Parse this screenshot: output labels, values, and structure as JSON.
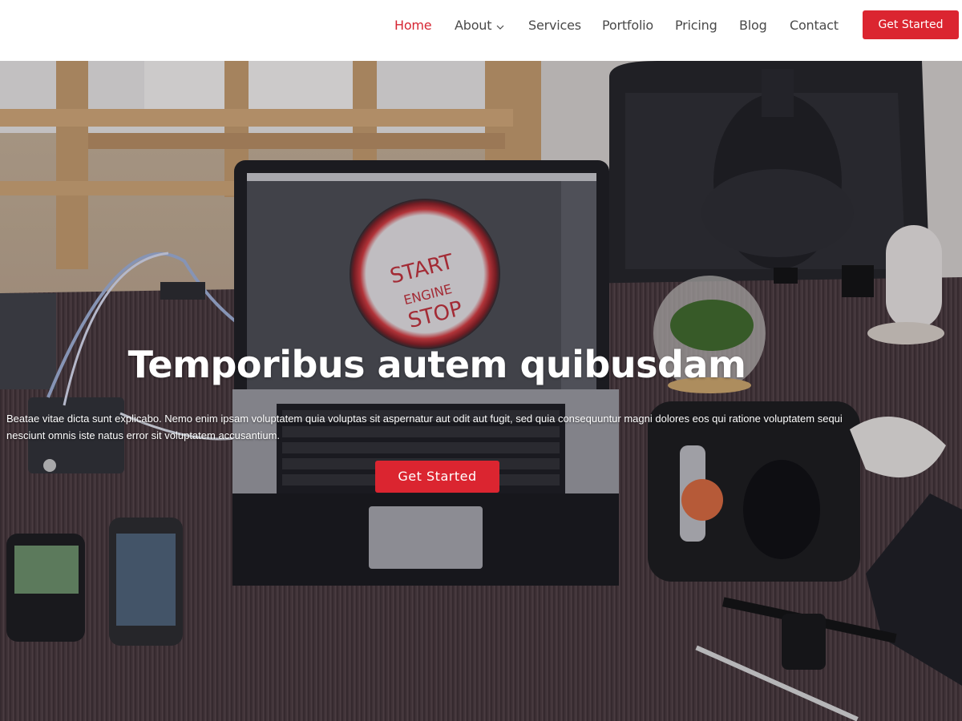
{
  "nav": {
    "items": [
      {
        "label": "Home",
        "active": true
      },
      {
        "label": "About",
        "has_dropdown": true
      },
      {
        "label": "Services"
      },
      {
        "label": "Portfolio"
      },
      {
        "label": "Pricing"
      },
      {
        "label": "Blog"
      },
      {
        "label": "Contact"
      }
    ],
    "cta_label": "Get Started"
  },
  "hero": {
    "title": "Temporibus autem quibusdam",
    "subtitle": "Beatae vitae dicta sunt explicabo. Nemo enim ipsam voluptatem quia voluptas sit aspernatur aut odit aut fugit, sed quia consequuntur magni dolores eos qui ratione voluptatem sequi nesciunt omnis iste natus error sit voluptatem accusantium.",
    "button_label": "Get Started",
    "screen_text": [
      "START",
      "ENGINE",
      "STOP"
    ]
  },
  "colors": {
    "accent": "#db2530",
    "nav_text": "#4a4a4a",
    "active": "#d62633"
  }
}
